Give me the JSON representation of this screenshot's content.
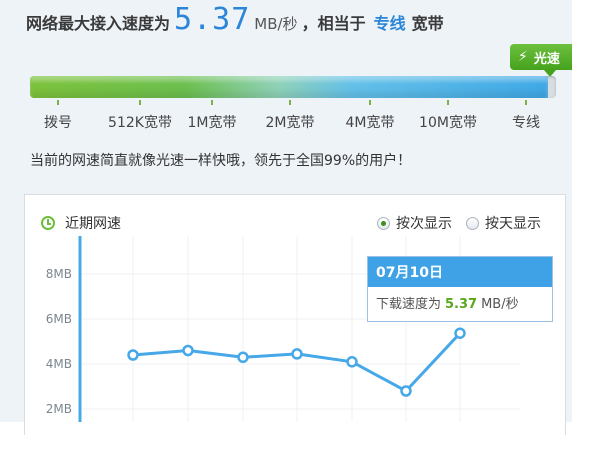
{
  "header": {
    "prefix": "网络最大接入速度为",
    "speed": "5.37",
    "unit": "MB/秒",
    "middle": "，相当于",
    "line_type": "专线",
    "suffix": "宽带"
  },
  "badge": {
    "label": "光速",
    "icon": "lightning-icon"
  },
  "speed_bar": {
    "fill_fraction": 0.985,
    "tiers": [
      "拨号",
      "512K宽带",
      "1M宽带",
      "2M宽带",
      "4M宽带",
      "10M宽带",
      "专线"
    ]
  },
  "note": "当前的网速简直就像光速一样快哦，领先于全国99%的用户！",
  "history": {
    "title": "近期网速",
    "options": [
      {
        "label": "按次显示",
        "checked": true
      },
      {
        "label": "按天显示",
        "checked": false
      }
    ]
  },
  "tooltip": {
    "date": "07月10日",
    "label": "下载速度为",
    "value": "5.37",
    "unit": "MB/秒"
  },
  "colors": {
    "accent": "#2b86d9",
    "line": "#46a8e8",
    "badge_green": "#5ab52d",
    "tooltip_head": "#3fa1e6"
  },
  "chart_data": {
    "type": "line",
    "title": "近期网速",
    "y_ticks": [
      "8MB",
      "6MB",
      "4MB",
      "2MB"
    ],
    "y_tick_values": [
      8,
      6,
      4,
      2
    ],
    "ylim": [
      1.5,
      9.2
    ],
    "series": [
      {
        "values": [
          4.4,
          4.6,
          4.3,
          4.45,
          4.1,
          2.8,
          5.37
        ]
      }
    ],
    "grid": true
  }
}
